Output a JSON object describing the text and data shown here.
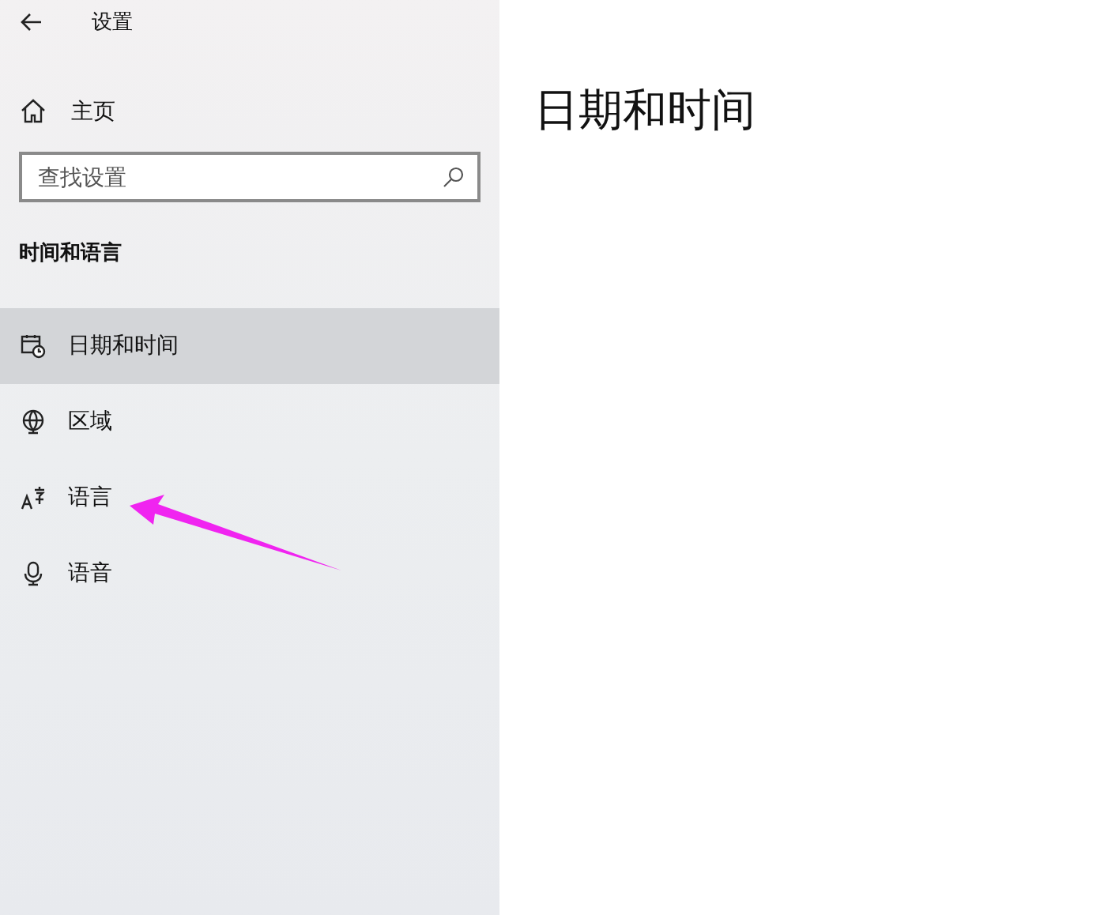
{
  "window": {
    "title": "设置"
  },
  "sidebar": {
    "home": "主页",
    "search": {
      "placeholder": "查找设置"
    },
    "section": "时间和语言",
    "items": [
      {
        "label": "日期和时间",
        "kind": "calendar",
        "selected": true
      },
      {
        "label": "区域",
        "kind": "globe",
        "selected": false
      },
      {
        "label": "语言",
        "kind": "language",
        "selected": false
      },
      {
        "label": "语音",
        "kind": "mic",
        "selected": false
      }
    ]
  },
  "content": {
    "heading": "日期和时间"
  }
}
